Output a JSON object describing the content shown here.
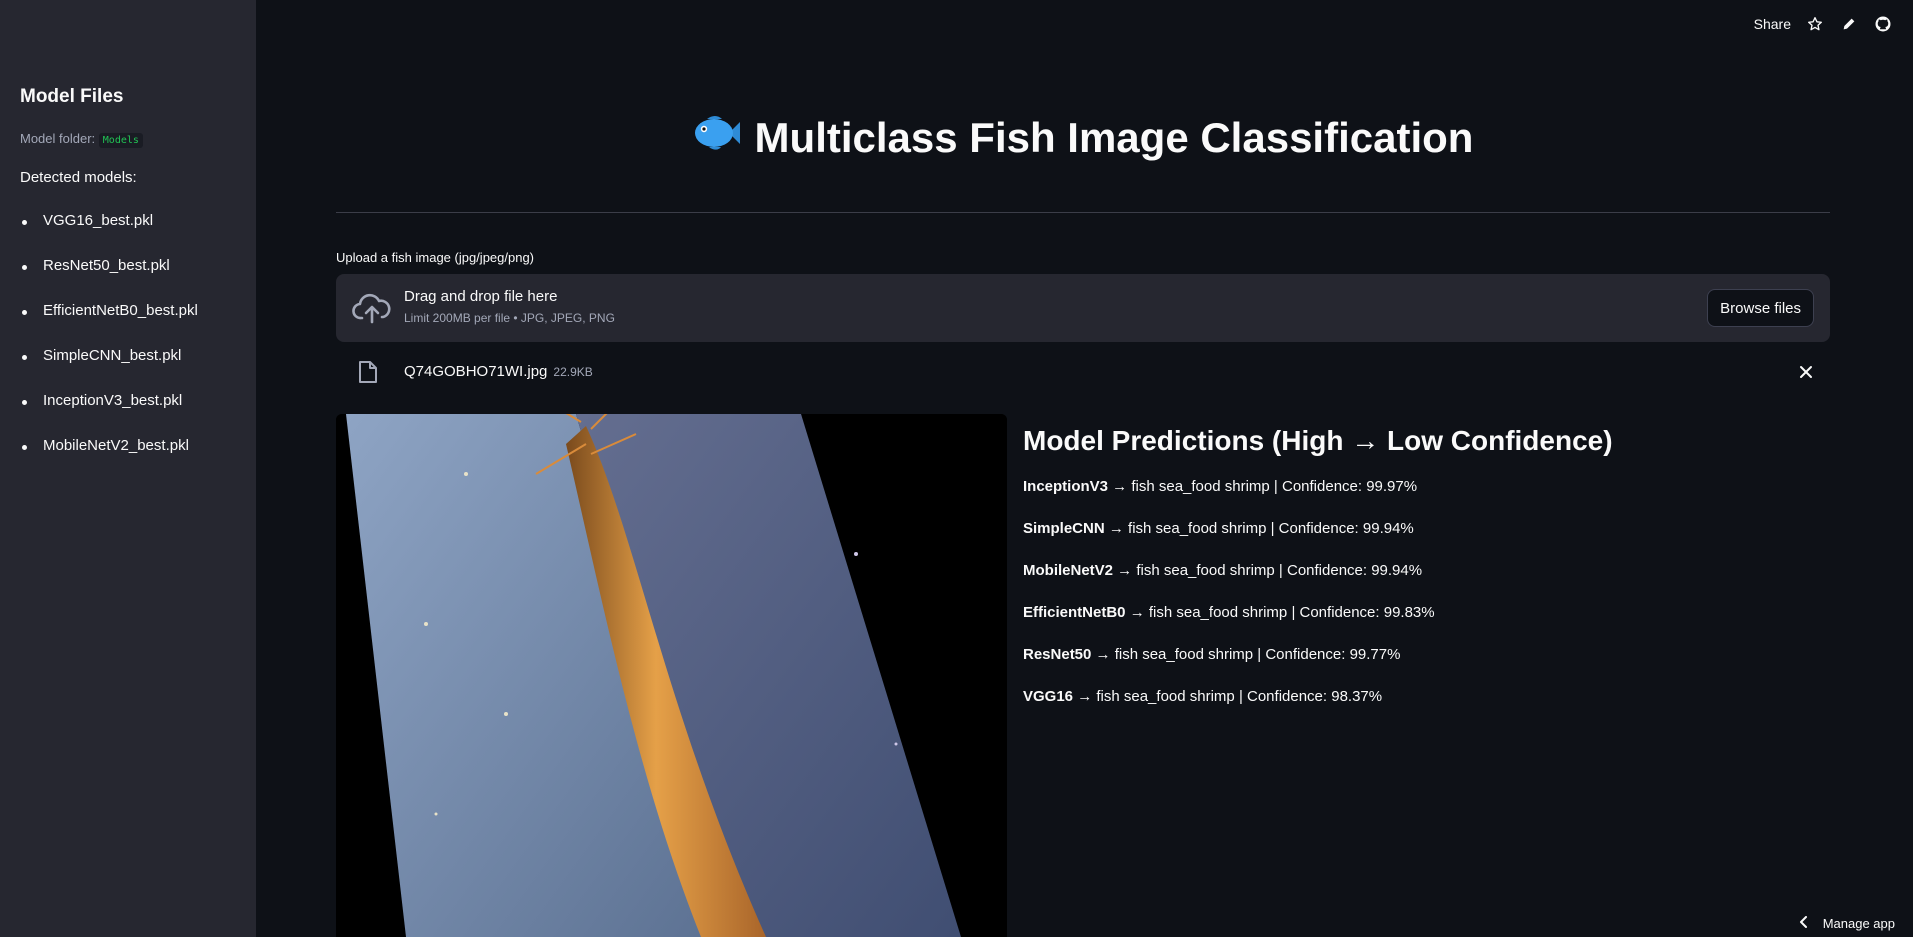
{
  "sidebar": {
    "title": "Model Files",
    "folder_label": "Model folder:",
    "folder_value": "Models",
    "detected_label": "Detected models:",
    "models": [
      "VGG16_best.pkl",
      "ResNet50_best.pkl",
      "EfficientNetB0_best.pkl",
      "SimpleCNN_best.pkl",
      "InceptionV3_best.pkl",
      "MobileNetV2_best.pkl"
    ]
  },
  "toolbar": {
    "share_label": "Share",
    "icons": [
      "star-icon",
      "pencil-icon",
      "github-icon"
    ]
  },
  "main": {
    "title": "Multiclass Fish Image Classification",
    "title_icon": "fish-emoji",
    "upload_label": "Upload a fish image (jpg/jpeg/png)",
    "dropzone": {
      "main": "Drag and drop file here",
      "sub": "Limit 200MB per file • JPG, JPEG, PNG",
      "browse_label": "Browse files"
    },
    "file": {
      "name": "Q74GOBHO71WI.jpg",
      "size": "22.9KB"
    },
    "predictions_title": "Model Predictions (High → Low Confidence)",
    "predictions": [
      {
        "model": "InceptionV3",
        "text": " → fish sea_food shrimp | Confidence: 99.97%"
      },
      {
        "model": "SimpleCNN",
        "text": " → fish sea_food shrimp | Confidence: 99.94%"
      },
      {
        "model": "MobileNetV2",
        "text": " → fish sea_food shrimp | Confidence: 99.94%"
      },
      {
        "model": "EfficientNetB0",
        "text": " → fish sea_food shrimp | Confidence: 99.83%"
      },
      {
        "model": "ResNet50",
        "text": " → fish sea_food shrimp | Confidence: 99.77%"
      },
      {
        "model": "VGG16",
        "text": " → fish sea_food shrimp | Confidence: 98.37%"
      }
    ]
  },
  "footer": {
    "manage_label": "Manage app"
  },
  "colors": {
    "background": "#0e1117",
    "sidebar": "#262730",
    "text": "#fafafa",
    "muted": "#a3a8b8",
    "code": "#21c354"
  }
}
